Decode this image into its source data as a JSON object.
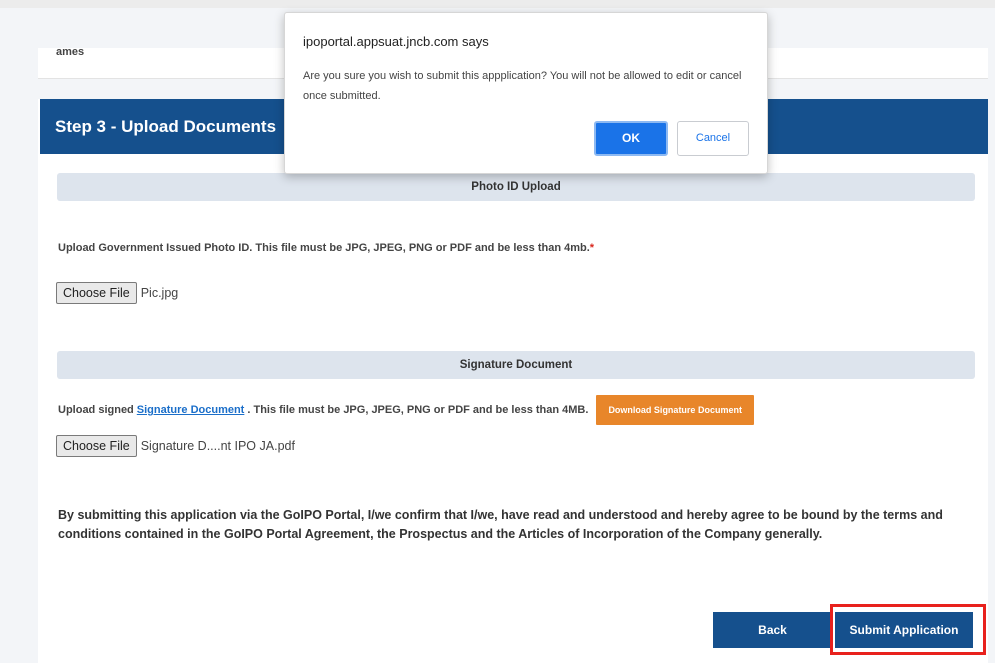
{
  "page": {
    "cut_off_text": "ames",
    "step_title": "Step 3 - Upload Documents"
  },
  "photo_section": {
    "heading": "Photo ID Upload",
    "requirement": "Upload Government Issued Photo ID. This file must be JPG, JPEG, PNG or PDF and be less than 4mb.",
    "required_marker": "*",
    "choose_label": "Choose File",
    "file_name": "Pic.jpg"
  },
  "signature_section": {
    "heading": "Signature Document",
    "prefix": "Upload signed",
    "link_text": "Signature Document",
    "suffix": ". This file must be JPG, JPEG, PNG or PDF and be less than 4MB.",
    "download_label": "Download Signature Document",
    "choose_label": "Choose File",
    "file_name": "Signature D....nt IPO JA.pdf"
  },
  "terms_text": "By submitting this application via the GoIPO Portal, I/we confirm that I/we, have read and understood and hereby agree to be bound by the terms and conditions contained in the GoIPO Portal Agreement, the Prospectus and the Articles of Incorporation of the Company generally.",
  "actions": {
    "back_label": "Back",
    "submit_label": "Submit Application"
  },
  "dialog": {
    "title": "ipoportal.appsuat.jncb.com says",
    "message": "Are you sure you wish to submit this appplication? You will not be allowed to edit or cancel once submitted.",
    "ok_label": "OK",
    "cancel_label": "Cancel"
  },
  "colors": {
    "primary": "#15508d",
    "accent_orange": "#e8862a",
    "highlight_red": "#e8211d",
    "dialog_ok": "#1a73e8"
  }
}
